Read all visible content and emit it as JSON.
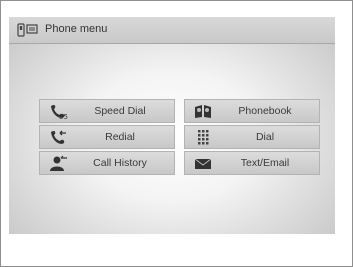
{
  "header": {
    "title": "Phone menu"
  },
  "menu": {
    "speed_dial": "Speed Dial",
    "phonebook": "Phonebook",
    "redial": "Redial",
    "dial": "Dial",
    "call_history": "Call History",
    "text_email": "Text/Email"
  }
}
